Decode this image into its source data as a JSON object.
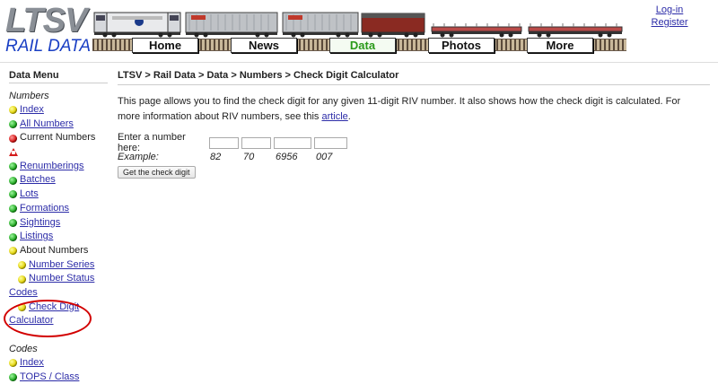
{
  "header": {
    "logo_ltsv": "LTSV",
    "logo_rail": "RAIL DATA",
    "nav": [
      {
        "label": "Home"
      },
      {
        "label": "News"
      },
      {
        "label": "Data"
      },
      {
        "label": "Photos"
      },
      {
        "label": "More"
      }
    ],
    "active_nav": "Data",
    "login": "Log-in",
    "register": "Register"
  },
  "sidebar": {
    "title": "Data Menu",
    "numbers_head": "Numbers",
    "numbers_items": [
      {
        "label": "Index",
        "dot": "yellow",
        "link": true
      },
      {
        "label": "All Numbers",
        "dot": "green",
        "link": true
      },
      {
        "label": "Current Numbers",
        "dot": "red",
        "link": false
      },
      {
        "label": "",
        "dot": "warn",
        "link": false
      },
      {
        "label": "Renumberings",
        "dot": "green",
        "link": true
      },
      {
        "label": "Batches",
        "dot": "green",
        "link": true
      },
      {
        "label": "Lots",
        "dot": "green",
        "link": true
      },
      {
        "label": "Formations",
        "dot": "green",
        "link": true
      },
      {
        "label": "Sightings",
        "dot": "green",
        "link": true
      },
      {
        "label": "Listings",
        "dot": "green",
        "link": true
      },
      {
        "label": "About Numbers",
        "dot": "yellow",
        "link": false
      }
    ],
    "about_sub": [
      {
        "label": "Number Series",
        "dot": "yellow"
      },
      {
        "label": "Number Status",
        "dot": "yellow"
      }
    ],
    "codes_link": "Codes",
    "check_digit_1": "Check Digit",
    "check_digit_2": "Calculator",
    "codes_head": "Codes",
    "codes_items": [
      {
        "label": "Index",
        "dot": "yellow"
      },
      {
        "label": "TOPS / Class",
        "dot": "green"
      }
    ]
  },
  "main": {
    "breadcrumb": "LTSV > Rail Data > Data > Numbers > Check Digit Calculator",
    "intro": "This page allows you to find the check digit for any given 11-digit RIV number. It also shows how the check digit is calculated. For more information about RIV numbers, see this ",
    "intro_link": "article",
    "intro_end": ".",
    "enter_label": "Enter a number here:",
    "example_label": "Example:",
    "example_parts": [
      "82",
      "70",
      "6956",
      "007"
    ],
    "button_label": "Get the check digit"
  }
}
